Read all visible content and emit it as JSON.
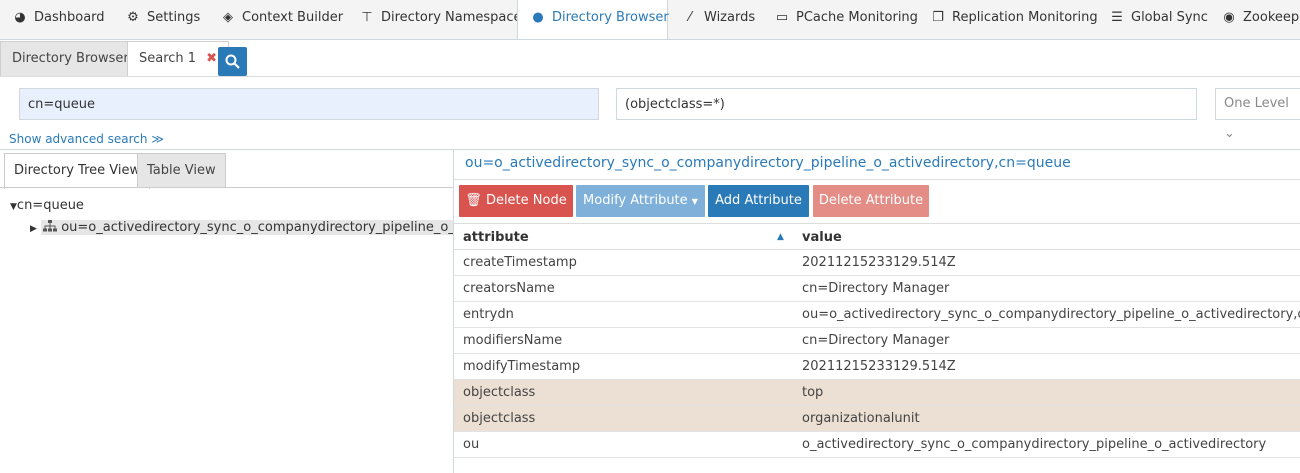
{
  "topnav": {
    "tabs": [
      {
        "label": "Dashboard",
        "icon": "dashboard-icon",
        "glyph": "◕"
      },
      {
        "label": "Settings",
        "icon": "gears-icon",
        "glyph": "⚙"
      },
      {
        "label": "Context Builder",
        "icon": "cube-icon",
        "glyph": "◈"
      },
      {
        "label": "Directory Namespace",
        "icon": "sitemap-icon",
        "glyph": "⊤"
      },
      {
        "label": "Directory Browser",
        "icon": "globe-icon",
        "glyph": "●"
      },
      {
        "label": "Wizards",
        "icon": "magic-wand-icon",
        "glyph": "⁄"
      },
      {
        "label": "PCache Monitoring",
        "icon": "desktop-icon",
        "glyph": "▭"
      },
      {
        "label": "Replication Monitoring",
        "icon": "copy-icon",
        "glyph": "❐"
      },
      {
        "label": "Global Sync",
        "icon": "list-icon",
        "glyph": "☰"
      },
      {
        "label": "Zookeeper",
        "icon": "eye-icon",
        "glyph": "◉"
      }
    ],
    "active_index": 4
  },
  "subtabs": {
    "directory_browser": "Directory Browser",
    "search1": "Search 1",
    "close_glyph": "✖"
  },
  "search": {
    "base_dn": "cn=queue",
    "filter": "(objectclass=*)",
    "scope": "One Level",
    "scope_glyph": "⌄",
    "advanced_link": "Show advanced search ≫"
  },
  "left_panel": {
    "tabs": {
      "tree": "Directory Tree View",
      "table": "Table View"
    },
    "tree": {
      "root": "cn=queue",
      "child": "ou=o_activedirectory_sync_o_companydirectory_pipeline_o_activedirectory,cn=queue"
    }
  },
  "right_panel": {
    "dn": "ou=o_activedirectory_sync_o_companydirectory_pipeline_o_activedirectory,cn=queue",
    "buttons": {
      "delete_node": "Delete Node",
      "modify_attribute": "Modify Attribute",
      "add_attribute": "Add Attribute",
      "delete_attribute": "Delete Attribute"
    },
    "table": {
      "col_attribute": "attribute",
      "col_value": "value",
      "rows": [
        {
          "attribute": "createTimestamp",
          "value": "20211215233129.514Z"
        },
        {
          "attribute": "creatorsName",
          "value": "cn=Directory Manager"
        },
        {
          "attribute": "entrydn",
          "value": "ou=o_activedirectory_sync_o_companydirectory_pipeline_o_activedirectory,cn=queue"
        },
        {
          "attribute": "modifiersName",
          "value": "cn=Directory Manager"
        },
        {
          "attribute": "modifyTimestamp",
          "value": "20211215233129.514Z"
        },
        {
          "attribute": "objectclass",
          "value": "top"
        },
        {
          "attribute": "objectclass",
          "value": "organizationalunit"
        },
        {
          "attribute": "ou",
          "value": "o_activedirectory_sync_o_companydirectory_pipeline_o_activedirectory"
        }
      ]
    }
  },
  "colors": {
    "accent": "#2a7ab8",
    "delete_node": "#d9534f",
    "modify_attribute": "#7fb0d9",
    "add_attribute": "#2a7ab8",
    "delete_attribute": "#e38d86",
    "highlight_row": "#ecdfd3"
  }
}
